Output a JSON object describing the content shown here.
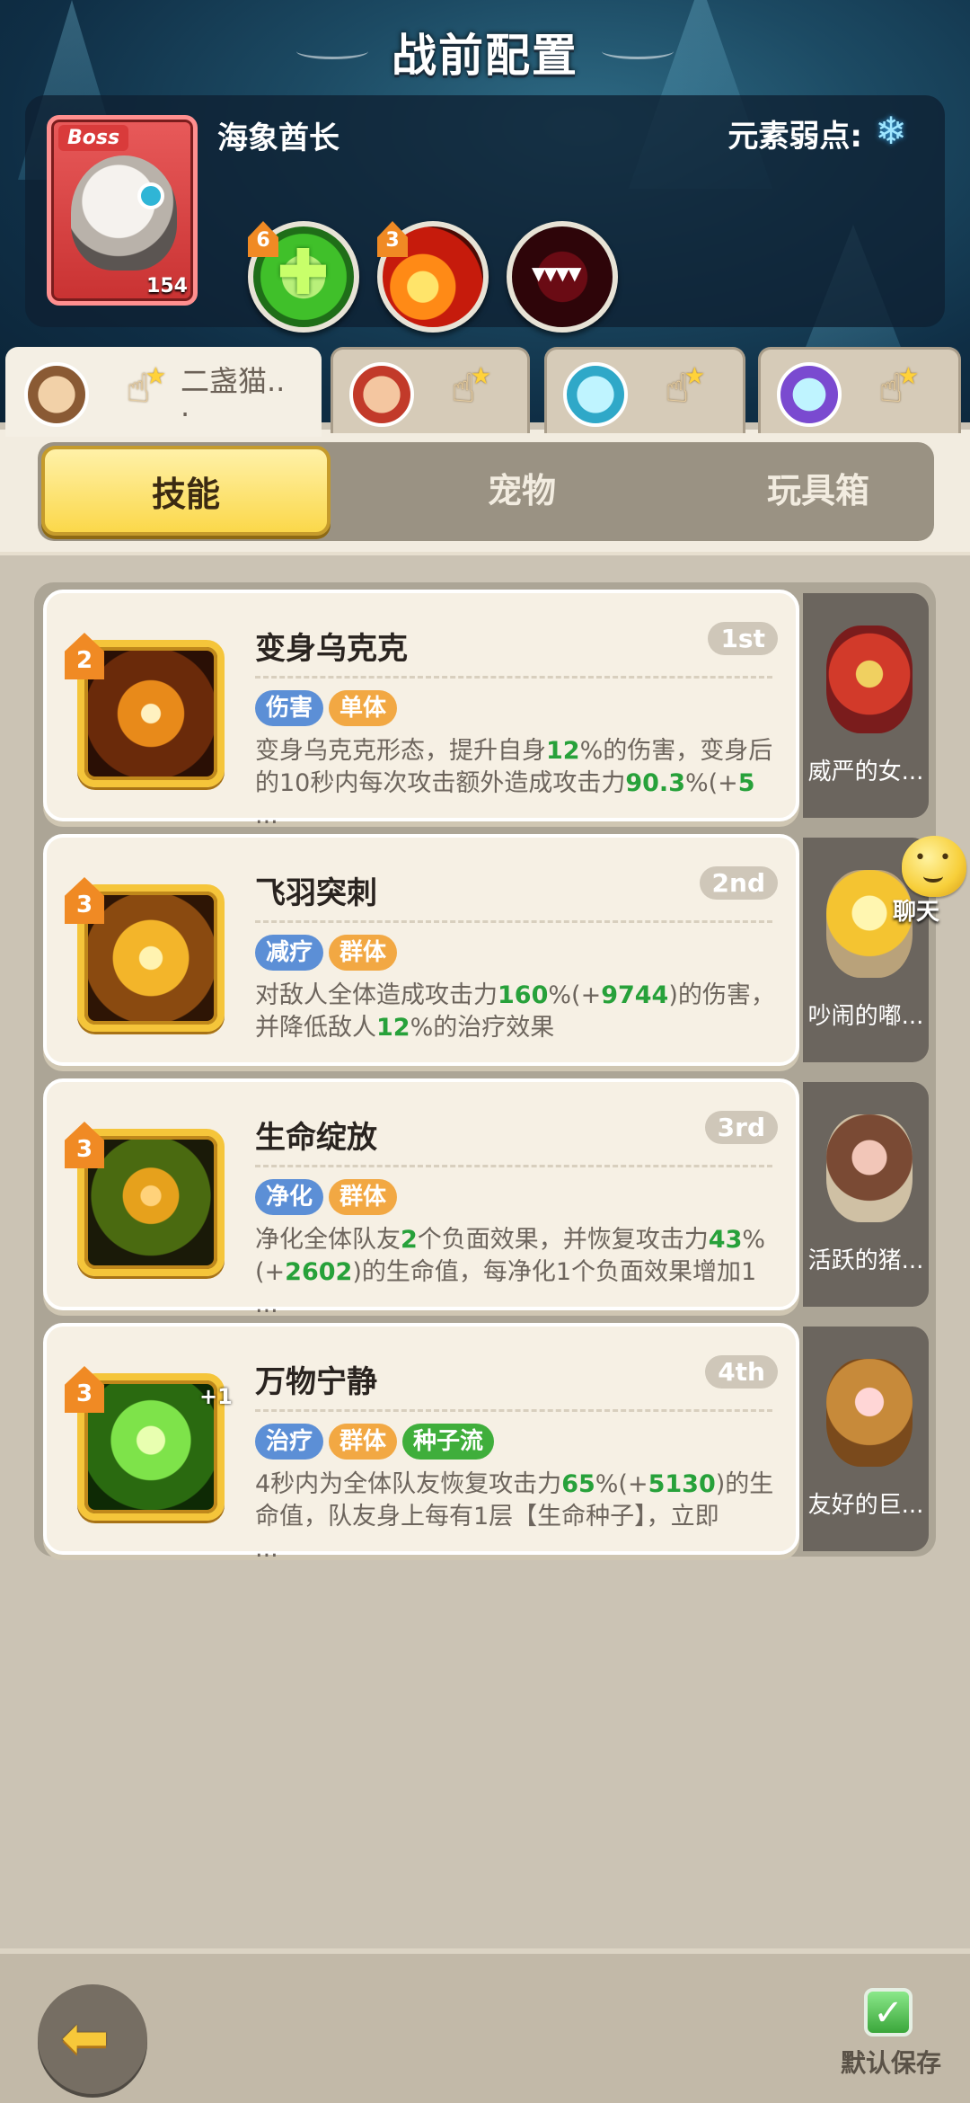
{
  "header": {
    "title": "战前配置"
  },
  "boss": {
    "badge": "Boss",
    "name": "海象酋长",
    "level": "154",
    "weakness_label": "元素弱点:",
    "weakness_icon": "snowflake-icon",
    "skills": [
      {
        "level": "6",
        "icon": "heal-cross-icon"
      },
      {
        "level": "3",
        "icon": "fire-swirl-icon"
      },
      {
        "level": "",
        "icon": "monster-mouth-icon"
      }
    ]
  },
  "characters": [
    {
      "name_line1": "二盏猫..",
      "name_line2": ".",
      "active": true
    },
    {
      "name_line1": "",
      "name_line2": "",
      "active": false
    },
    {
      "name_line1": "",
      "name_line2": "",
      "active": false
    },
    {
      "name_line1": "",
      "name_line2": "",
      "active": false
    }
  ],
  "tabs": [
    "技能",
    "宠物",
    "玩具箱"
  ],
  "skills": [
    {
      "level": "2",
      "name": "变身乌克克",
      "order": "1st",
      "tags": [
        "伤害",
        "单体"
      ],
      "desc_parts": [
        "变身乌克克形态，提升自身",
        "12",
        "%的伤害，变身后的10秒内每次攻击额外造成攻击力",
        "90.3",
        "%(+",
        "5",
        "..."
      ],
      "pet": "威严的女..."
    },
    {
      "level": "3",
      "name": "飞羽突刺",
      "order": "2nd",
      "tags": [
        "减疗",
        "群体"
      ],
      "desc_parts": [
        "对敌人全体造成攻击力",
        "160",
        "%(+",
        "9744",
        ")的伤害，并降低敌人",
        "12",
        "%的治疗效果"
      ],
      "pet": "吵闹的嘟..."
    },
    {
      "level": "3",
      "name": "生命绽放",
      "order": "3rd",
      "tags": [
        "净化",
        "群体"
      ],
      "desc_parts": [
        "净化全体队友",
        "2",
        "个负面效果，并恢复攻击力",
        "43",
        "%(+",
        "2602",
        ")的生命值，每净化1个负面效果增加1",
        "..."
      ],
      "pet": "活跃的猪..."
    },
    {
      "level": "3",
      "name": "万物宁静",
      "order": "4th",
      "icon_badge": "+1",
      "tags": [
        "治疗",
        "群体",
        "种子流"
      ],
      "desc_parts": [
        "4秒内为全体队友恢复攻击力",
        "65",
        "%(+",
        "5130",
        ")的生命值，队友身上每有1层【生命种子】，立即",
        "..."
      ],
      "pet": "友好的巨..."
    }
  ],
  "chat": {
    "label": "聊天"
  },
  "footer": {
    "save_label": "默认保存"
  },
  "colors": {
    "accent_yellow": "#fbd84a",
    "highlight_green": "#27a13a",
    "tag_blue": "#5c8fd6",
    "tag_orange": "#f2a843",
    "tag_green": "#3fae3b",
    "panel_dark": "#0f2e45"
  }
}
